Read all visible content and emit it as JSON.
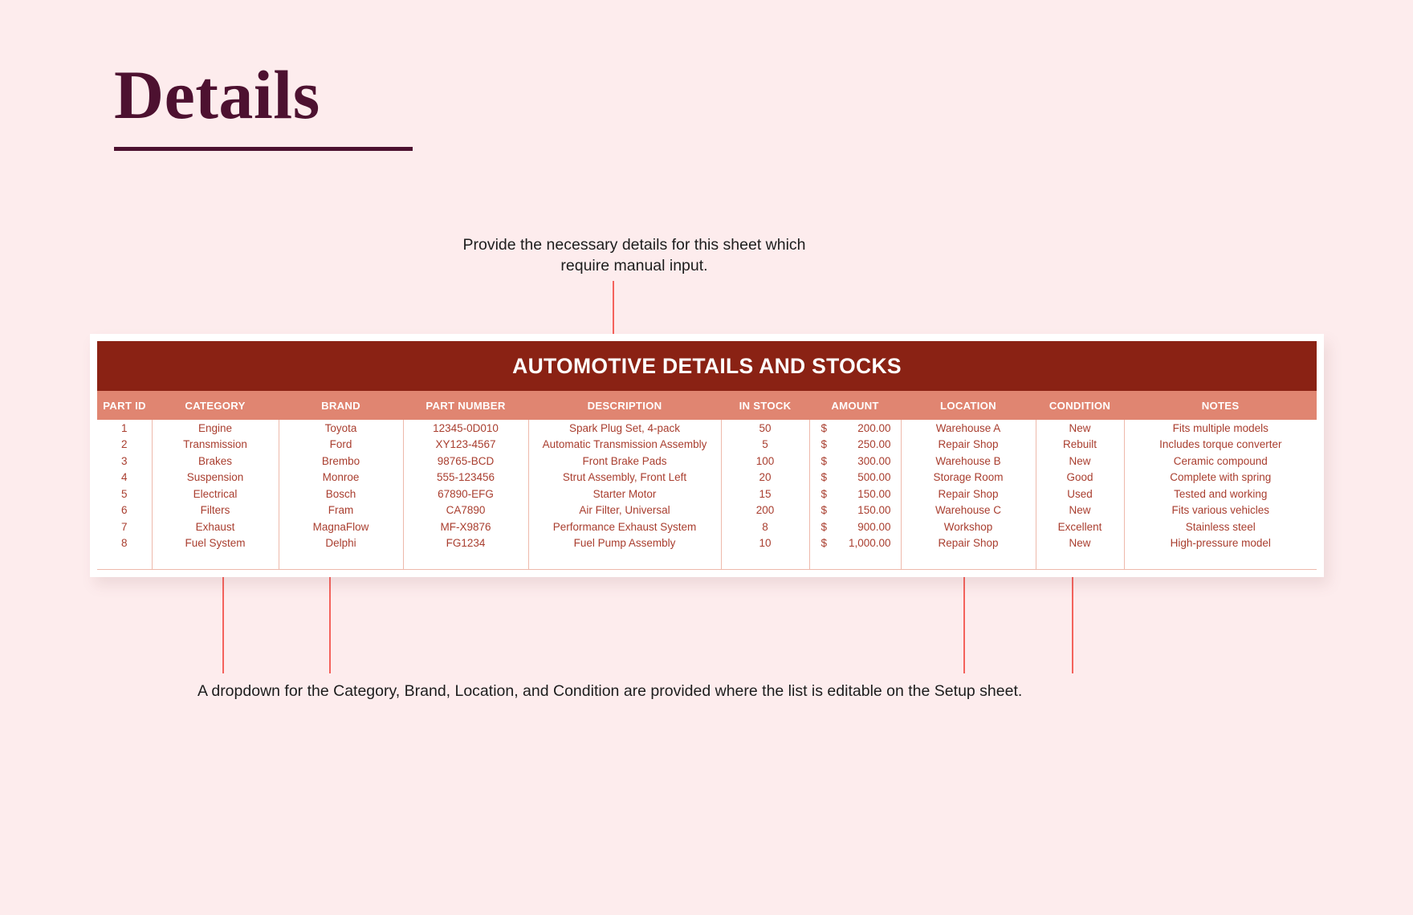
{
  "page": {
    "title": "Details",
    "background_color": "#fdeced",
    "title_color": "#4d1130"
  },
  "callouts": {
    "top": "Provide the necessary details for this sheet which require manual input.",
    "bottom": "A dropdown for the Category, Brand, Location, and Condition are provided where the list is editable on the Setup sheet."
  },
  "table": {
    "banner": "AUTOMOTIVE DETAILS AND STOCKS",
    "banner_bg": "#8a2214",
    "header_bg": "#e08571",
    "body_text_color": "#a93e2f",
    "columns": [
      "PART ID",
      "CATEGORY",
      "BRAND",
      "PART NUMBER",
      "DESCRIPTION",
      "IN STOCK",
      "AMOUNT",
      "LOCATION",
      "CONDITION",
      "NOTES"
    ],
    "currency_symbol": "$",
    "rows": [
      {
        "part_id": "1",
        "category": "Engine",
        "brand": "Toyota",
        "part_number": "12345-0D010",
        "description": "Spark Plug Set, 4-pack",
        "in_stock": "50",
        "amount": "200.00",
        "location": "Warehouse A",
        "condition": "New",
        "notes": "Fits multiple models"
      },
      {
        "part_id": "2",
        "category": "Transmission",
        "brand": "Ford",
        "part_number": "XY123-4567",
        "description": "Automatic Transmission Assembly",
        "in_stock": "5",
        "amount": "250.00",
        "location": "Repair Shop",
        "condition": "Rebuilt",
        "notes": "Includes torque converter"
      },
      {
        "part_id": "3",
        "category": "Brakes",
        "brand": "Brembo",
        "part_number": "98765-BCD",
        "description": "Front Brake Pads",
        "in_stock": "100",
        "amount": "300.00",
        "location": "Warehouse B",
        "condition": "New",
        "notes": "Ceramic compound"
      },
      {
        "part_id": "4",
        "category": "Suspension",
        "brand": "Monroe",
        "part_number": "555-123456",
        "description": "Strut Assembly, Front Left",
        "in_stock": "20",
        "amount": "500.00",
        "location": "Storage Room",
        "condition": "Good",
        "notes": "Complete with spring"
      },
      {
        "part_id": "5",
        "category": "Electrical",
        "brand": "Bosch",
        "part_number": "67890-EFG",
        "description": "Starter Motor",
        "in_stock": "15",
        "amount": "150.00",
        "location": "Repair Shop",
        "condition": "Used",
        "notes": "Tested and working"
      },
      {
        "part_id": "6",
        "category": "Filters",
        "brand": "Fram",
        "part_number": "CA7890",
        "description": "Air Filter, Universal",
        "in_stock": "200",
        "amount": "150.00",
        "location": "Warehouse C",
        "condition": "New",
        "notes": "Fits various vehicles"
      },
      {
        "part_id": "7",
        "category": "Exhaust",
        "brand": "MagnaFlow",
        "part_number": "MF-X9876",
        "description": "Performance Exhaust System",
        "in_stock": "8",
        "amount": "900.00",
        "location": "Workshop",
        "condition": "Excellent",
        "notes": "Stainless steel"
      },
      {
        "part_id": "8",
        "category": "Fuel System",
        "brand": "Delphi",
        "part_number": "FG1234",
        "description": "Fuel Pump Assembly",
        "in_stock": "10",
        "amount": "1,000.00",
        "location": "Repair Shop",
        "condition": "New",
        "notes": "High-pressure model"
      }
    ]
  }
}
